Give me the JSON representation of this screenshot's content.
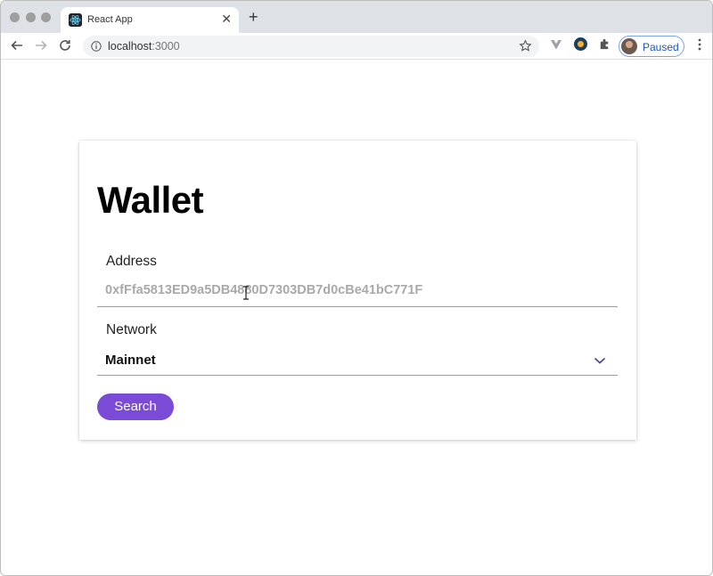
{
  "browser": {
    "tab_title": "React App",
    "tab_close_glyph": "✕",
    "new_tab_glyph": "+",
    "url_host": "localhost",
    "url_port": ":3000",
    "profile_status": "Paused",
    "icons": {
      "back": "arrow-left-icon",
      "forward": "arrow-right-icon",
      "reload": "reload-icon",
      "info": "info-icon",
      "bookmark": "star-icon",
      "extensions": "puzzle-icon",
      "menu": "kebab-menu-icon"
    }
  },
  "wallet": {
    "title": "Wallet",
    "address": {
      "label": "Address",
      "placeholder": "0xfFfa5813ED9a5DB4880D7303DB7d0cBe41bC771F",
      "value": ""
    },
    "network": {
      "label": "Network",
      "selected": "Mainnet"
    },
    "search_label": "Search"
  },
  "colors": {
    "accent": "#7b4ad6",
    "tabbar": "#dee1e6",
    "profile_chip_border": "#7aa7e6"
  }
}
